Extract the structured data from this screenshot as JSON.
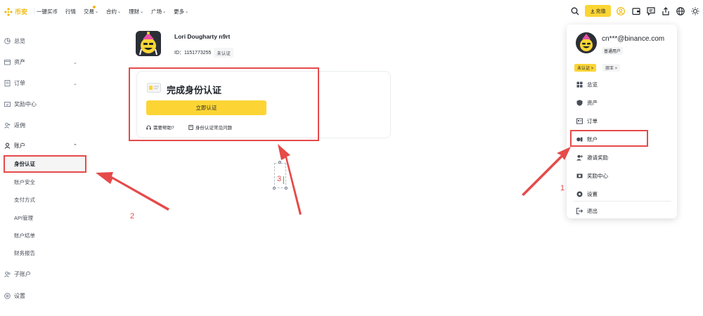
{
  "brand": {
    "name": "币安",
    "color": "#f0b90b"
  },
  "nav": {
    "items": [
      {
        "label": "一键买币",
        "has_dropdown": false
      },
      {
        "label": "行情",
        "has_dropdown": false
      },
      {
        "label": "交易",
        "has_dropdown": true
      },
      {
        "label": "合约",
        "has_dropdown": true
      },
      {
        "label": "理财",
        "has_dropdown": true
      },
      {
        "label": "广场",
        "has_dropdown": true
      },
      {
        "label": "更多",
        "has_dropdown": true
      }
    ],
    "deposit_label": "充值",
    "icons": [
      "search-icon",
      "download-icon",
      "user-icon",
      "wallet-icon",
      "message-icon",
      "upload-icon",
      "globe-icon",
      "sun-icon"
    ]
  },
  "sidebar": {
    "items": [
      {
        "label": "总览",
        "icon": "dashboard-icon"
      },
      {
        "label": "资产",
        "icon": "wallet-icon",
        "expandable": true
      },
      {
        "label": "订单",
        "icon": "order-icon",
        "expandable": true
      },
      {
        "label": "奖励中心",
        "icon": "reward-icon"
      },
      {
        "label": "返佣",
        "icon": "referral-icon"
      },
      {
        "label": "账户",
        "icon": "user-icon",
        "expandable": true,
        "expanded": true
      },
      {
        "label": "子账户",
        "icon": "subaccount-icon"
      },
      {
        "label": "设置",
        "icon": "settings-icon"
      }
    ],
    "sub_items": [
      "身份认证",
      "账户安全",
      "支付方式",
      "API管理",
      "账户结单",
      "财务报告"
    ],
    "active_sub": "身份认证"
  },
  "profile": {
    "username": "Lori Dougharty n9rt",
    "id_label": "ID：",
    "id_value": "1151773255",
    "status_badge": "未认证"
  },
  "verify_card": {
    "title": "完成身份认证",
    "button_label": "立即认证",
    "help_label": "需要帮助?",
    "faq_label": "身份认证常见问题"
  },
  "annotations": {
    "step1": "1",
    "step2": "2",
    "step3": "3",
    "color": "#e64a4a"
  },
  "dropdown": {
    "email": "cn***@binance.com",
    "user_type": "普通用户",
    "badge_unverified": "未认证 >",
    "badge_tag": "挪亚 ×",
    "items": [
      {
        "label": "总览",
        "icon": "dashboard-icon"
      },
      {
        "label": "资产",
        "icon": "shield-icon"
      },
      {
        "label": "订单",
        "icon": "order-icon"
      },
      {
        "label": "账户",
        "icon": "account-icon"
      },
      {
        "label": "邀请奖励",
        "icon": "invite-icon"
      },
      {
        "label": "奖励中心",
        "icon": "reward-icon"
      },
      {
        "label": "设置",
        "icon": "settings-icon"
      },
      {
        "label": "退出",
        "icon": "logout-icon"
      }
    ]
  },
  "colors": {
    "accent": "#fcd535",
    "text": "#1e2329",
    "muted": "#474d57"
  }
}
